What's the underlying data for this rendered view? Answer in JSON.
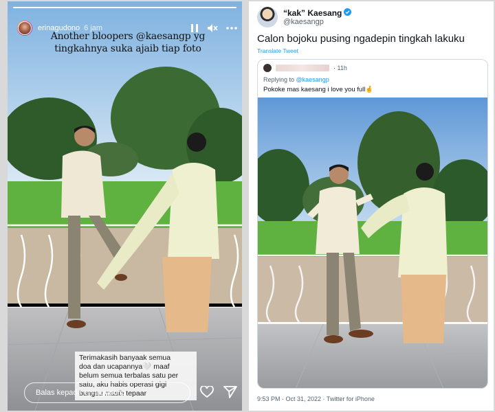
{
  "story": {
    "username": "erinagudono",
    "time": "6 jam",
    "progress": 1.0,
    "caption_line1": "Another bloopers @kaesangp yg",
    "caption_line2": "tingkahnya suka ajaib tiap foto",
    "note_lines": [
      "Terimakasih banyaak semua",
      "doa dan ucapannya🤍 maaf",
      "belum semua terbalas satu per",
      "satu, aku habis operasi gigi",
      "bungsu masih tepaar"
    ],
    "reply_placeholder": "Balas kepada erinagudono",
    "icons": [
      "more-icon",
      "mute-icon",
      "pause-icon",
      "heart-icon",
      "send-icon"
    ]
  },
  "tweet": {
    "display_name": "“kak” Kaesang",
    "handle": "@kaesangp",
    "text": "Calon bojoku pusing ngadepin tingkah lakuku",
    "translate": "Translate Tweet",
    "quote": {
      "time": "· 11h",
      "replying_prefix": "Replying to ",
      "replying_handle": "@kaesangp",
      "text": "Pokoke mas kaesang i love you full🤞"
    },
    "meta": "9:53 PM · Oct 31, 2022 · Twitter for iPhone",
    "colors": {
      "link": "#1d9bf0",
      "verified": "#1d9bf0"
    }
  }
}
